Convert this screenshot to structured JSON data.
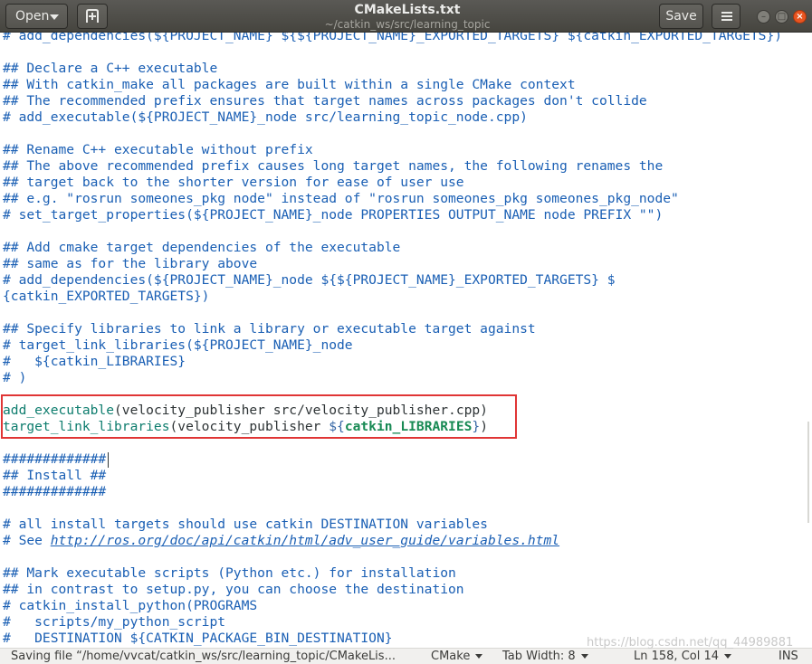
{
  "header": {
    "open_label": "Open",
    "title": "CMakeLists.txt",
    "subtitle": "~/catkin_ws/src/learning_topic",
    "save_label": "Save"
  },
  "editor": {
    "lines": {
      "l0": "# add_dependencies(${PROJECT_NAME} ${${PROJECT_NAME}_EXPORTED_TARGETS} ${catkin_EXPORTED_TARGETS})",
      "l2": "## Declare a C++ executable",
      "l3": "## With catkin_make all packages are built within a single CMake context",
      "l4": "## The recommended prefix ensures that target names across packages don't collide",
      "l5": "# add_executable(${PROJECT_NAME}_node src/learning_topic_node.cpp)",
      "l7": "## Rename C++ executable without prefix",
      "l8": "## The above recommended prefix causes long target names, the following renames the",
      "l9": "## target back to the shorter version for ease of user use",
      "l10": "## e.g. \"rosrun someones_pkg node\" instead of \"rosrun someones_pkg someones_pkg_node\"",
      "l11": "# set_target_properties(${PROJECT_NAME}_node PROPERTIES OUTPUT_NAME node PREFIX \"\")",
      "l13": "## Add cmake target dependencies of the executable",
      "l14": "## same as for the library above",
      "l15": "# add_dependencies(${PROJECT_NAME}_node ${${PROJECT_NAME}_EXPORTED_TARGETS} $",
      "l16": "{catkin_EXPORTED_TARGETS})",
      "l18": "## Specify libraries to link a library or executable target against",
      "l19": "# target_link_libraries(${PROJECT_NAME}_node",
      "l20": "#   ${catkin_LIBRARIES}",
      "l21": "# )",
      "l23": {
        "cmd": "add_executable",
        "rest": "(velocity_publisher src/velocity_publisher.cpp)"
      },
      "l24": {
        "cmd": "target_link_libraries",
        "mid": "(velocity_publisher ",
        "var_open": "${",
        "var": "catkin_LIBRARIES",
        "var_close": "}",
        "end": ")"
      },
      "l26": "#############",
      "l27": "## Install ##",
      "l28": "#############",
      "l30": "# all install targets should use catkin DESTINATION variables",
      "l31": {
        "pre": "# See ",
        "url": "http://ros.org/doc/api/catkin/html/adv_user_guide/variables.html"
      },
      "l33": "## Mark executable scripts (Python etc.) for installation",
      "l34": "## in contrast to setup.py, you can choose the destination",
      "l35": "# catkin_install_python(PROGRAMS",
      "l36": "#   scripts/my_python_script",
      "l37": "#   DESTINATION ${CATKIN_PACKAGE_BIN_DESTINATION}"
    }
  },
  "status": {
    "message": "Saving file “/home/vvcat/catkin_ws/src/learning_topic/CMakeLis...",
    "language": "CMake",
    "tab_width": "Tab Width: 8",
    "position": "Ln 158, Col 14",
    "mode": "INS"
  },
  "watermark": "https://blog.csdn.net/qq_44989881",
  "colors": {
    "header_bg": "#4f4e49",
    "close_button": "#e95420",
    "comment": "#1a5fb4",
    "command": "#0e7d6e",
    "variable": "#188a54",
    "highlight_box": "#e03535"
  },
  "icons": {
    "new_tab": "new-document-tab-icon",
    "menu": "hamburger-menu-icon"
  }
}
